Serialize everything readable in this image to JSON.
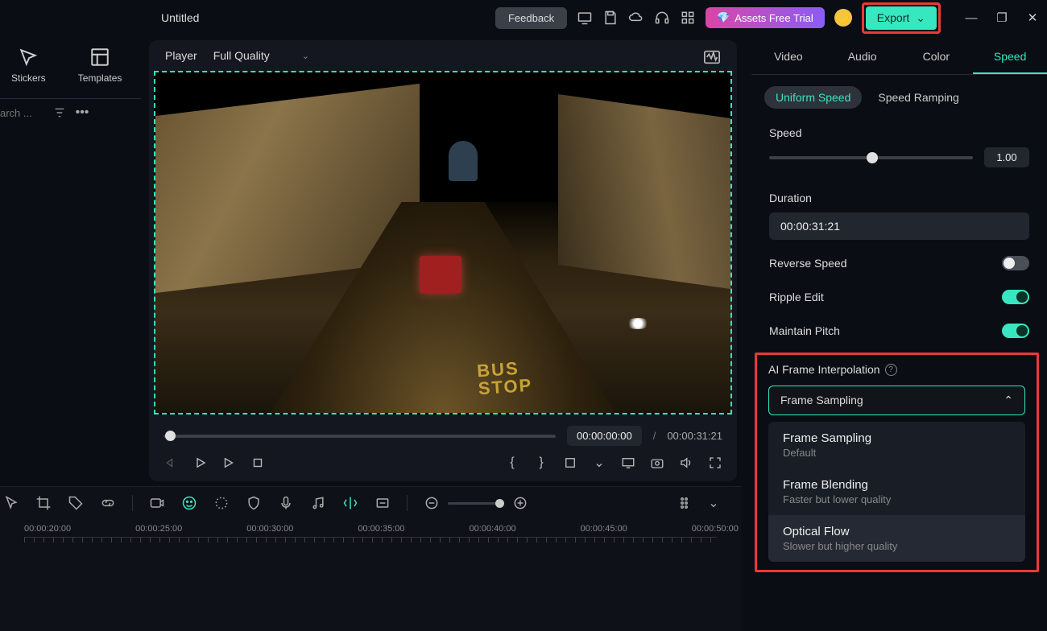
{
  "title": "Untitled",
  "topbar": {
    "feedback": "Feedback",
    "assets": "Assets Free Trial",
    "export": "Export"
  },
  "sidebar": {
    "stickers": "Stickers",
    "templates": "Templates",
    "search_placeholder": "arch ..."
  },
  "player": {
    "label": "Player",
    "quality": "Full Quality",
    "current_time": "00:00:00:00",
    "total_time": "00:00:31:21",
    "bus_stop": "BUS\nSTOP"
  },
  "right": {
    "tabs": {
      "video": "Video",
      "audio": "Audio",
      "color": "Color",
      "speed": "Speed"
    },
    "modes": {
      "uniform": "Uniform Speed",
      "ramping": "Speed Ramping"
    },
    "speed_label": "Speed",
    "speed_value": "1.00",
    "duration_label": "Duration",
    "duration_value": "00:00:31:21",
    "reverse_label": "Reverse Speed",
    "ripple_label": "Ripple Edit",
    "pitch_label": "Maintain Pitch",
    "interp_label": "AI Frame Interpolation",
    "interp_selected": "Frame Sampling",
    "options": [
      {
        "title": "Frame Sampling",
        "sub": "Default"
      },
      {
        "title": "Frame Blending",
        "sub": "Faster but lower quality"
      },
      {
        "title": "Optical Flow",
        "sub": "Slower but higher quality"
      }
    ]
  },
  "timeline": {
    "marks": [
      "00:00:20:00",
      "00:00:25:00",
      "00:00:30:00",
      "00:00:35:00",
      "00:00:40:00",
      "00:00:45:00",
      "00:00:50:00"
    ]
  }
}
